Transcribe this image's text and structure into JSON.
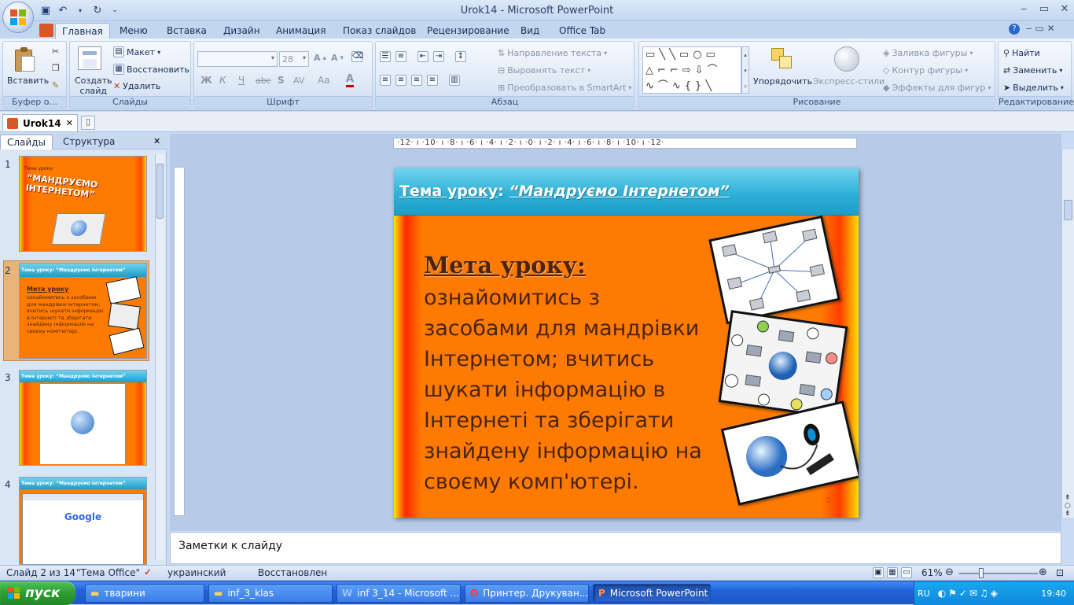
{
  "window": {
    "title": "Urok14 - Microsoft PowerPoint"
  },
  "ribbon_tabs": [
    "Главная",
    "Меню",
    "Вставка",
    "Дизайн",
    "Анимация",
    "Показ слайдов",
    "Рецензирование",
    "Вид",
    "Office Tab"
  ],
  "groups": {
    "clipboard": {
      "label": "Буфер о...",
      "paste": "Вставить"
    },
    "slides": {
      "label": "Слайды",
      "new_slide": "Создать слайд",
      "layout": "Макет",
      "reset": "Восстановить",
      "delete": "Удалить"
    },
    "font": {
      "label": "Шрифт",
      "font_size": "28",
      "bold": "Ж",
      "italic": "К",
      "underline": "Ч",
      "strike": "abc",
      "shadow": "S",
      "spacing": "AV",
      "case": "Aa",
      "color": "A"
    },
    "paragraph": {
      "label": "Абзац",
      "text_direction": "Направление текста",
      "align_text": "Выровнять текст",
      "smartart": "Преобразовать в SmartArt"
    },
    "drawing": {
      "label": "Рисование",
      "arrange": "Упорядочить",
      "quick_styles": "Экспресс-стили",
      "fill": "Заливка фигуры",
      "outline": "Контур фигуры",
      "effects": "Эффекты для фигур"
    },
    "editing": {
      "label": "Редактирование",
      "find": "Найти",
      "replace": "Заменить",
      "select": "Выделить"
    }
  },
  "doc_tab": {
    "name": "Urok14"
  },
  "pane_tabs": {
    "slides": "Слайды",
    "outline": "Структура"
  },
  "thumbnails": [
    {
      "num": "1",
      "title_small": "Тема уроку:",
      "title_big": "“МАНДРУЄМО ІНТЕРНЕТОМ”"
    },
    {
      "num": "2",
      "header": "Тема уроку: “Мандруємо Інтернетом”",
      "goal": "Мета уроку",
      "text": "ознайомитись з засобами для мандрівки Інтернетом; вчитись шукати інформацію в Інтернеті та зберігати знайдену інформацію на своєму комп'ютері."
    },
    {
      "num": "3",
      "header": "Тема уроку: “Мандруємо Інтернетом”"
    },
    {
      "num": "4",
      "header": "Тема уроку: “Мандруємо Інтернетом”",
      "google": "Google"
    }
  ],
  "ruler_h": "·12· ı ·10· ı ·8· ı ·6· ı ·4· ı ·2· ı ·0· ı ·2· ı ·4· ı ·6· ı ·8· ı ·10· ı ·12·",
  "slide": {
    "title_label": "Тема уроку",
    "title_colon": ":",
    "title_topic": "“Мандруємо Інтернетом”",
    "goal_label": "Мета уроку",
    "goal_colon": ":",
    "goal_text": "ознайомитись з засобами для мандрівки Інтернетом; вчитись шукати інформацію в Інтернеті та зберігати знайдену інформацію на своєму комп'ютері.",
    "number": "2"
  },
  "notes": {
    "placeholder": "Заметки к слайду"
  },
  "status": {
    "slide": "Слайд 2 из 14",
    "theme": "\"Тема Office\"",
    "language": "украинский",
    "state": "Восстановлен",
    "zoom": "61%"
  },
  "taskbar": {
    "start": "пуск",
    "tasks": [
      "тварини",
      "inf_3_klas",
      "inf 3_14 - Microsoft ...",
      "Принтер. Друкуван...",
      "Microsoft PowerPoint ..."
    ],
    "lang": "RU",
    "clock": "19:40"
  },
  "colors": {
    "slide_bg": "#ff7b00",
    "header_bg": "#2aaed6",
    "text": "#4a2411",
    "taskbar": "#2362d9"
  }
}
